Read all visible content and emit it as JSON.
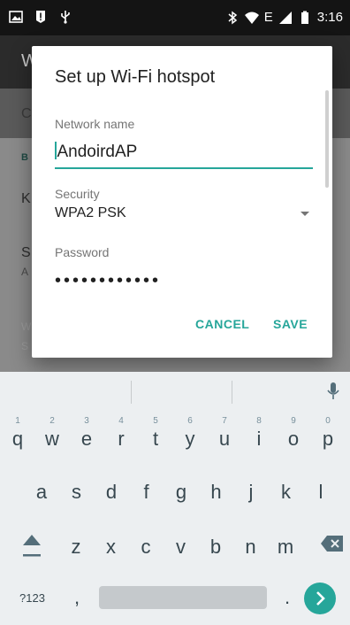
{
  "status_bar": {
    "time": "3:16",
    "network": "E",
    "icons": [
      "image-icon",
      "alert-icon",
      "usb-icon",
      "bluetooth-icon",
      "wifi-icon",
      "signal-icon",
      "battery-icon"
    ]
  },
  "background": {
    "app_title": "W",
    "rows": [
      "C",
      "B",
      "K",
      "S",
      "A",
      "W",
      "S"
    ]
  },
  "dialog": {
    "title": "Set up Wi-Fi hotspot",
    "network_name_label": "Network name",
    "network_name_value": "AndoirdAP",
    "security_label": "Security",
    "security_value": "WPA2 PSK",
    "password_label": "Password",
    "password_value": "••••••••••••",
    "cancel_label": "CANCEL",
    "save_label": "SAVE"
  },
  "keyboard": {
    "row1": [
      {
        "key": "q",
        "hint": "1"
      },
      {
        "key": "w",
        "hint": "2"
      },
      {
        "key": "e",
        "hint": "3"
      },
      {
        "key": "r",
        "hint": "4"
      },
      {
        "key": "t",
        "hint": "5"
      },
      {
        "key": "y",
        "hint": "6"
      },
      {
        "key": "u",
        "hint": "7"
      },
      {
        "key": "i",
        "hint": "8"
      },
      {
        "key": "o",
        "hint": "9"
      },
      {
        "key": "p",
        "hint": "0"
      }
    ],
    "row2": [
      "a",
      "s",
      "d",
      "f",
      "g",
      "h",
      "j",
      "k",
      "l"
    ],
    "row3": [
      "z",
      "x",
      "c",
      "v",
      "b",
      "n",
      "m"
    ],
    "symbols_label": "?123",
    "comma": ",",
    "period": ".",
    "accent_color": "#26a69a"
  }
}
